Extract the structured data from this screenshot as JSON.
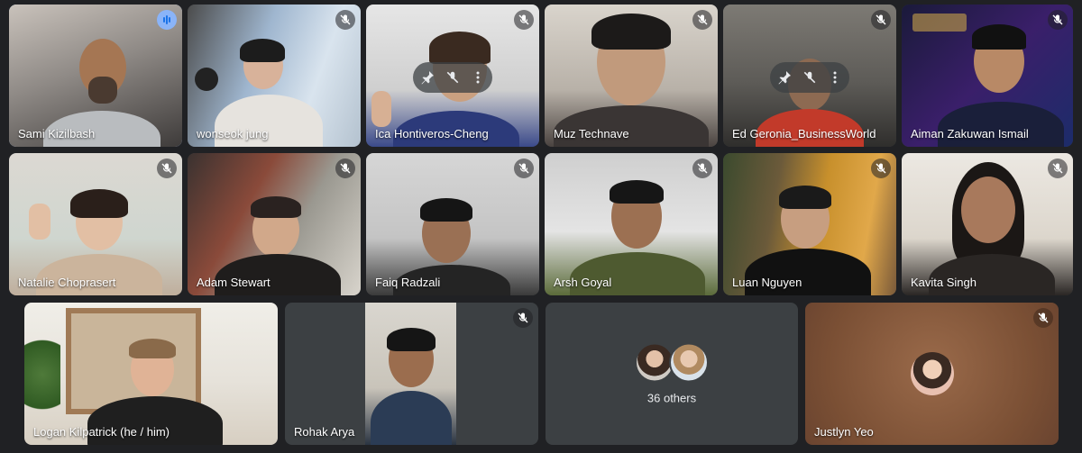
{
  "meeting": {
    "participants": [
      {
        "name": "Sami Kizilbash",
        "muted": false,
        "speaking": true
      },
      {
        "name": "wonseok jung",
        "muted": true
      },
      {
        "name": "Ica Hontiveros-Cheng",
        "muted": true
      },
      {
        "name": "Muz Technave",
        "muted": true
      },
      {
        "name": "Ed Geronia_BusinessWorld",
        "muted": true
      },
      {
        "name": "Aiman Zakuwan Ismail",
        "muted": true
      },
      {
        "name": "Natalie Choprasert",
        "muted": true
      },
      {
        "name": "Adam Stewart",
        "muted": true
      },
      {
        "name": "Faiq Radzali",
        "muted": true
      },
      {
        "name": "Arsh Goyal",
        "muted": true
      },
      {
        "name": "Luan Nguyen",
        "muted": true
      },
      {
        "name": "Kavita Singh",
        "muted": true
      },
      {
        "name": "Logan Kilpatrick (he / him)",
        "muted": false
      },
      {
        "name": "Rohak Arya",
        "muted": true
      },
      {
        "name": "Justlyn Yeo",
        "muted": true
      }
    ],
    "others": {
      "label": "36 others"
    }
  },
  "icons": {
    "mic_off": "mic-off-icon",
    "speaking": "audio-level-icon",
    "pin": "pin-icon",
    "more": "more-vert-icon"
  },
  "colors": {
    "background": "#202124",
    "tile": "#3c4043",
    "active_border": "#a8c7fa",
    "justlyn_bg": "#8a5a3c"
  }
}
